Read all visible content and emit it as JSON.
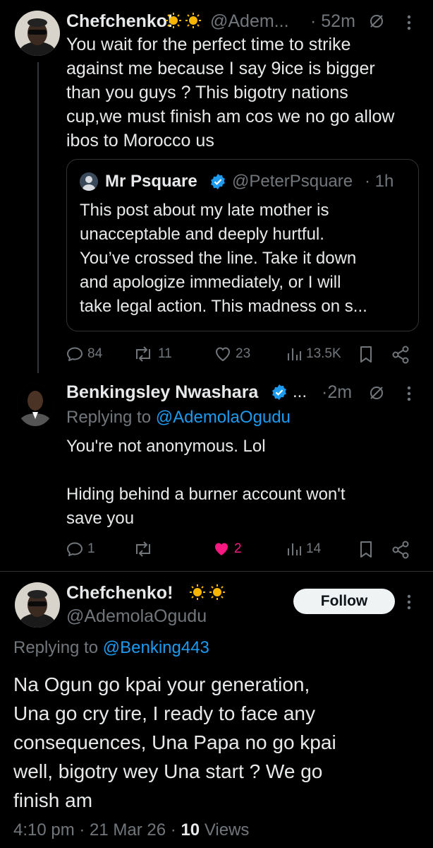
{
  "tweet1": {
    "name": "Chefchenko!",
    "handle": "@Adem...",
    "time": "· 52m",
    "text_lines": [
      "You wait for the perfect time to strike",
      "against me because I say 9ice is bigger",
      "than you guys ?  This bigotry nations",
      "cup,we must finish am cos we no go allow",
      "ibos to Morocco us"
    ],
    "quote": {
      "name": "Mr Psquare",
      "handle": "@PeterPsquare",
      "time": "· 1h",
      "text_lines": [
        "This post about my late mother is",
        "unacceptable and deeply hurtful.",
        "You’ve crossed the line. Take it down",
        "and apologize immediately, or I will",
        "take legal action. This madness on s..."
      ]
    },
    "actions": {
      "replies": "84",
      "reposts": "11",
      "likes": "23",
      "views": "13.5K"
    }
  },
  "tweet2": {
    "name": "Benkingsley Nwashara",
    "ellipsis": "...",
    "time": "·2m",
    "replying_prefix": "Replying to ",
    "replying_to": "@AdemolaOgudu",
    "text_lines": [
      "You're not anonymous. Lol",
      "",
      "Hiding behind a burner account won't",
      "save you"
    ],
    "actions": {
      "replies": "1",
      "reposts": "",
      "likes": "2",
      "views": "14"
    }
  },
  "tweet3": {
    "name": "Chefchenko!",
    "handle": "@AdemolaOgudu",
    "follow_label": "Follow",
    "replying_prefix": "Replying to ",
    "replying_to": "@Benking443",
    "text_lines": [
      "Na Ogun go kpai your generation,",
      "Una go cry tire, I ready to face any",
      "consequences, Una Papa no go kpai",
      "well, bigotry wey Una start ? We go",
      "finish am"
    ],
    "meta_time": "4:10 pm",
    "meta_date": "21 Mar 26",
    "meta_views_count": "10",
    "meta_views_label": "Views"
  },
  "colors": {
    "background": "#000000",
    "text": "#e7e9ea",
    "muted": "#71767b",
    "link": "#1d9bf0",
    "like_active": "#f91880",
    "verified": "#1d9bf0",
    "badge_sun": "#f7b500"
  }
}
